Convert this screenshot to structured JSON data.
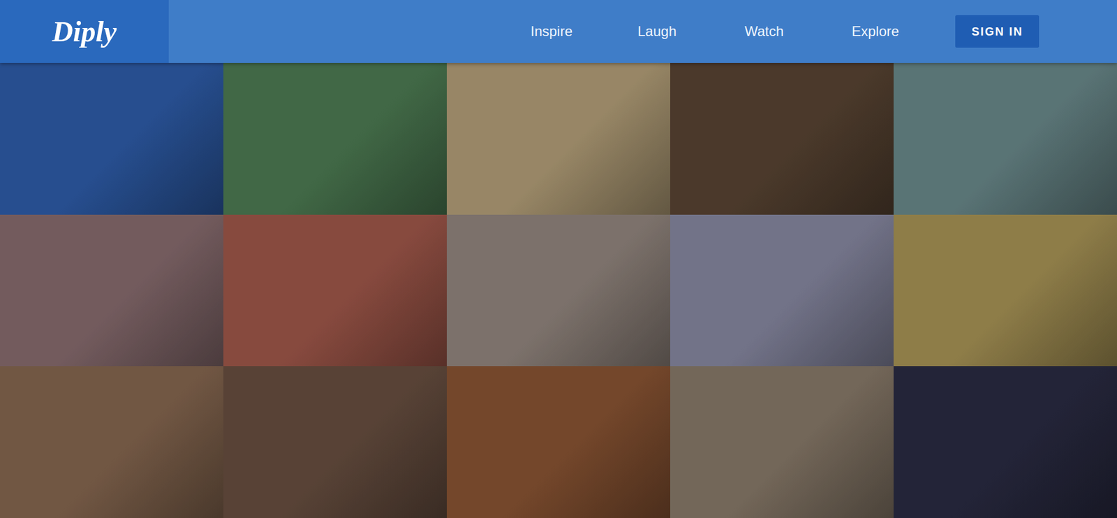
{
  "header": {
    "logo": "Diply",
    "nav": [
      {
        "label": "Inspire",
        "selected": false
      },
      {
        "label": "Laugh",
        "selected": false
      },
      {
        "label": "Watch",
        "selected": false
      },
      {
        "label": "Explore",
        "selected": false
      }
    ],
    "sign_in": "SIGN IN"
  },
  "grid": {
    "tiles": [
      {
        "color": "#2f5fae"
      },
      {
        "color": "#4f7f55"
      },
      {
        "color": "#b9a47c"
      },
      {
        "color": "#5b4634"
      },
      {
        "color": "#6d8d8f"
      },
      {
        "color": "#8c6f72"
      },
      {
        "color": "#a55a4c"
      },
      {
        "color": "#978a82"
      },
      {
        "color": "#8b8ca6"
      },
      {
        "color": "#ad9858"
      },
      {
        "color": "#8a6a52"
      },
      {
        "color": "#6b5142"
      },
      {
        "color": "#8d5634"
      },
      {
        "color": "#8c7d6c"
      },
      {
        "color": "#2b2c44"
      }
    ]
  }
}
